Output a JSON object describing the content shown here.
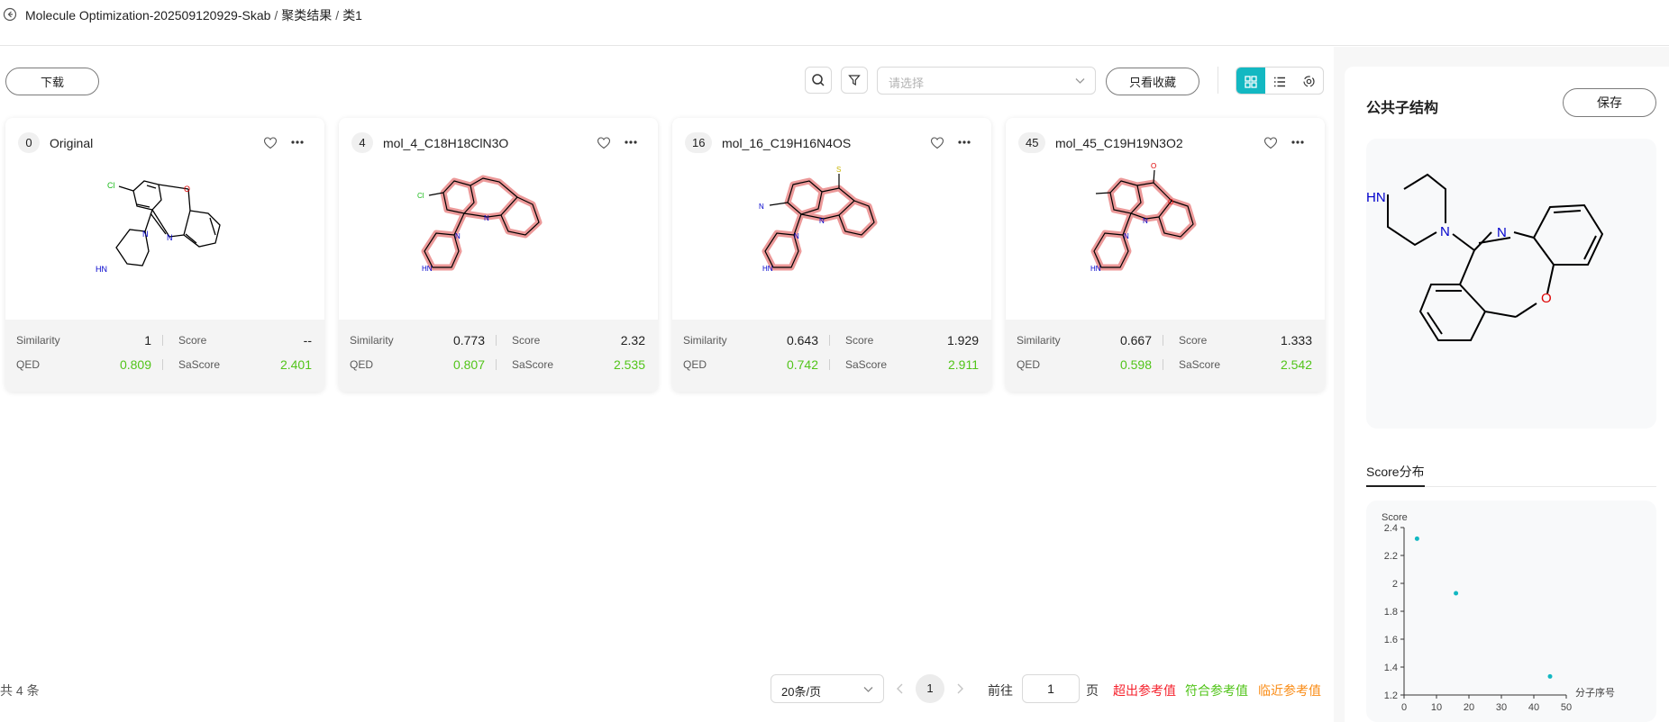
{
  "header": {
    "crumbs": [
      "Molecule Optimization-202509120929-Skab",
      "聚类结果",
      "类1"
    ],
    "separator": "/"
  },
  "toolbar": {
    "download_label": "下载",
    "select_placeholder": "请选择",
    "favorites_label": "只看收藏"
  },
  "labels": {
    "similarity": "Similarity",
    "score": "Score",
    "qed": "QED",
    "sascore": "SaScore"
  },
  "cards": [
    {
      "index": "0",
      "name": "Original",
      "similarity": "1",
      "score": "--",
      "qed": "0.809",
      "sascore": "2.401"
    },
    {
      "index": "4",
      "name": "mol_4_C18H18ClN3O",
      "similarity": "0.773",
      "score": "2.32",
      "qed": "0.807",
      "sascore": "2.535"
    },
    {
      "index": "16",
      "name": "mol_16_C19H16N4OS",
      "similarity": "0.643",
      "score": "1.929",
      "qed": "0.742",
      "sascore": "2.911"
    },
    {
      "index": "45",
      "name": "mol_45_C19H19N3O2",
      "similarity": "0.667",
      "score": "1.333",
      "qed": "0.598",
      "sascore": "2.542"
    }
  ],
  "atoms": {
    "cl": "Cl",
    "n": "N",
    "hn": "HN",
    "o": "O",
    "s": "S"
  },
  "pagination": {
    "total": "共 4 条",
    "page_size": "20条/页",
    "current_page": "1",
    "goto_prefix": "前往",
    "goto_value": "1",
    "goto_suffix": "页"
  },
  "legend": {
    "exceeds": "超出参考值",
    "meets": "符合参考值",
    "near": "临近参考值"
  },
  "colors": {
    "accent": "#13b8c2",
    "exceeds": "#f5222d",
    "meets": "#52c41a",
    "near": "#fa8c16",
    "highlight": "#e88080"
  },
  "right_panel": {
    "title": "公共子结构",
    "save_label": "保存",
    "tab_label": "Score分布"
  },
  "chart_data": {
    "type": "scatter",
    "ylabel": "Score",
    "xlabel": "分子序号",
    "xlim": [
      0,
      50
    ],
    "ylim": [
      1.2,
      2.4
    ],
    "xticks": [
      "0",
      "10",
      "20",
      "30",
      "40",
      "50"
    ],
    "yticks": [
      "1.2",
      "1.4",
      "1.6",
      "1.8",
      "2",
      "2.2",
      "2.4"
    ],
    "points": [
      {
        "x": 4,
        "y": 2.32
      },
      {
        "x": 16,
        "y": 1.929
      },
      {
        "x": 45,
        "y": 1.333
      }
    ],
    "color": "#13b8c2"
  }
}
